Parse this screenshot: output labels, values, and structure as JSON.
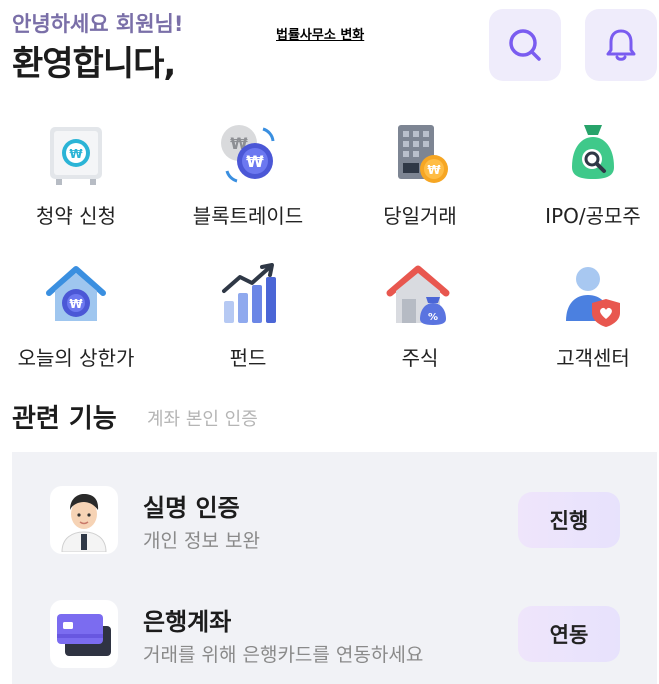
{
  "header": {
    "greeting_sub": "안녕하세요 회원님!",
    "greeting_main": "환영합니다,",
    "top_link": "법률사무소 변화",
    "search_icon": "search-icon",
    "bell_icon": "bell-icon"
  },
  "menu": [
    {
      "label": "청약 신청",
      "icon": "safe-won-icon"
    },
    {
      "label": "블록트레이드",
      "icon": "coin-exchange-icon"
    },
    {
      "label": "당일거래",
      "icon": "building-coin-icon"
    },
    {
      "label": "IPO/공모주",
      "icon": "money-bag-search-icon"
    },
    {
      "label": "오늘의 상한가",
      "icon": "house-won-icon"
    },
    {
      "label": "펀드",
      "icon": "bar-chart-up-icon"
    },
    {
      "label": "주식",
      "icon": "house-percent-icon"
    },
    {
      "label": "고객센터",
      "icon": "user-heart-shield-icon"
    }
  ],
  "related": {
    "title": "관련 기능",
    "subtitle": "계좌 본인 인증",
    "items": [
      {
        "title": "실명 인증",
        "desc": "개인 정보 보완",
        "action": "진행",
        "icon": "person-avatar-icon"
      },
      {
        "title": "은행계좌",
        "desc": "거래를 위해 은행카드를 연동하세요",
        "action": "연동",
        "icon": "bank-card-icon"
      }
    ]
  },
  "colors": {
    "accent": "#7a5cf0",
    "greeting_sub": "#7a6fa8",
    "header_button_bg": "#efecfb",
    "panel_bg": "#f1f2f6"
  }
}
